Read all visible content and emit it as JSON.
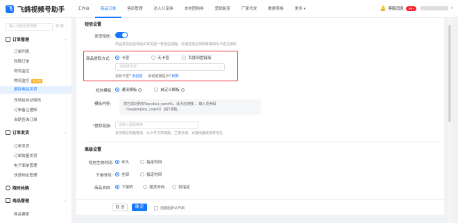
{
  "brand": {
    "title": "飞鸽视频号助手",
    "logo_glyph": "飞",
    "accent": "#1677ff"
  },
  "nav": [
    "工作台",
    "商品订单",
    "售后管理",
    "达人分享券",
    "本地团购券",
    "营销裂变",
    "厂家代发",
    "数据表格",
    "更多 ▾"
  ],
  "header": {
    "service": "客服消息",
    "badge": "99+"
  },
  "sidebar": {
    "search_placeholder": "输入功能名称搜索",
    "groups": [
      {
        "label": "订单管理",
        "items": [
          "订单列表",
          "轻微订单",
          "物流监控",
          "物流监控",
          "虚拟商品发货",
          "改地址自动审核",
          "订单备注通知",
          "自助查询订单"
        ]
      },
      {
        "label": "订单发货",
        "items": [
          "订单发货",
          "订单批量发货",
          "电子面单管理",
          "快递地址管理"
        ]
      },
      {
        "label": "限时抢购"
      },
      {
        "label": "商品管理",
        "items": [
          "商品搬家"
        ]
      }
    ],
    "new_tag": "新功能"
  },
  "form": {
    "basic_title": "短信设置",
    "auto_send_label": "发货短信:",
    "auto_send_hint": "商品发货后自动给买家发送一条短信提醒，可通过短信领取券或填写卡密兑换码",
    "method_label": "商品提取方式:",
    "methods": [
      "卡密",
      "无卡密",
      "百度网盘链接"
    ],
    "card_select_placeholder": "请选择卡密",
    "no_card_text": "没有卡密?",
    "create_link": "去创建",
    "auto_reply_text": "启动链接提示?",
    "refresh_link": "刷新",
    "template_label": "短信模板:",
    "templates": [
      "通用模板",
      "自定义模板"
    ],
    "template_content_label": "模板内容:",
    "template_lines": [
      "您已成功购买%product_name%，请点击链接：，输入兑换码",
      "（%redemption_code%）进行领取。"
    ],
    "link_label": "*提取链接:",
    "link_placeholder": "请输入提取链接",
    "link_hint": "支持填写网盘链接、公众号文章链接、兰奏外链、百度网盘链接等地址",
    "advanced_title": "高级设置",
    "effect_label": "短信生效时间:",
    "effect_options": [
      "永久",
      "指定时间"
    ],
    "unsend_label": "下单时间:",
    "unsend_options": [
      "全部",
      "指定时间"
    ],
    "goods_label": "商品去向:",
    "goods_options": [
      "下架的",
      "混货去向",
      "仅指定"
    ]
  },
  "footer": {
    "cancel": "取 消",
    "confirm": "确 定",
    "default_open": "创建后默认开启"
  }
}
